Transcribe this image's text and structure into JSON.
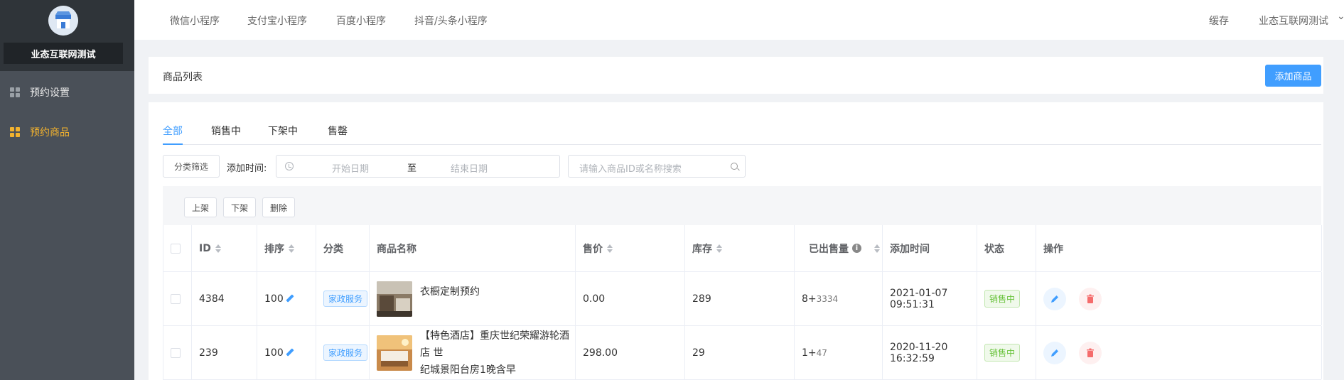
{
  "sidebar": {
    "shop_name": "业态互联网测试",
    "items": [
      {
        "label": "预约设置",
        "active": false
      },
      {
        "label": "预约商品",
        "active": true
      }
    ]
  },
  "topnav": {
    "tabs": [
      "微信小程序",
      "支付宝小程序",
      "百度小程序",
      "抖音/头条小程序"
    ],
    "cache": "缓存",
    "user": "业态互联网测试"
  },
  "title_card": {
    "title": "商品列表",
    "add_button": "添加商品"
  },
  "tabs": [
    {
      "label": "全部",
      "active": true
    },
    {
      "label": "销售中",
      "active": false
    },
    {
      "label": "下架中",
      "active": false
    },
    {
      "label": "售罄",
      "active": false
    }
  ],
  "filters": {
    "category_button": "分类筛选",
    "date_label": "添加时间:",
    "start_placeholder": "开始日期",
    "separator": "至",
    "end_placeholder": "结束日期",
    "search_placeholder": "请输入商品ID或名称搜索"
  },
  "bulk_actions": [
    "上架",
    "下架",
    "删除"
  ],
  "table": {
    "headers": {
      "id": "ID",
      "sort": "排序",
      "category": "分类",
      "name": "商品名称",
      "price": "售价",
      "stock": "库存",
      "sold": "已出售量",
      "added": "添加时间",
      "status": "状态",
      "ops": "操作"
    },
    "rows": [
      {
        "id": "4384",
        "sort": "100",
        "category": "家政服务",
        "name": "衣橱定制预约",
        "price": "0.00",
        "stock": "289",
        "sold_main": "8+",
        "sold_sub": "3334",
        "added": "2021-01-07 09:51:31",
        "status": "销售中"
      },
      {
        "id": "239",
        "sort": "100",
        "category": "家政服务",
        "name_line1": "【特色酒店】重庆世纪荣耀游轮酒店 世",
        "name_line2": "纪城景阳台房1晚含早",
        "price": "298.00",
        "stock": "29",
        "sold_main": "1+",
        "sold_sub": "47",
        "added": "2020-11-20 16:32:59",
        "status": "销售中"
      }
    ]
  },
  "colors": {
    "sidebar_bg": "#4a5058",
    "accent": "#409eff",
    "active_menu": "#f2b22e",
    "status_green": "#67c23a",
    "delete_red": "#f56c6c"
  }
}
